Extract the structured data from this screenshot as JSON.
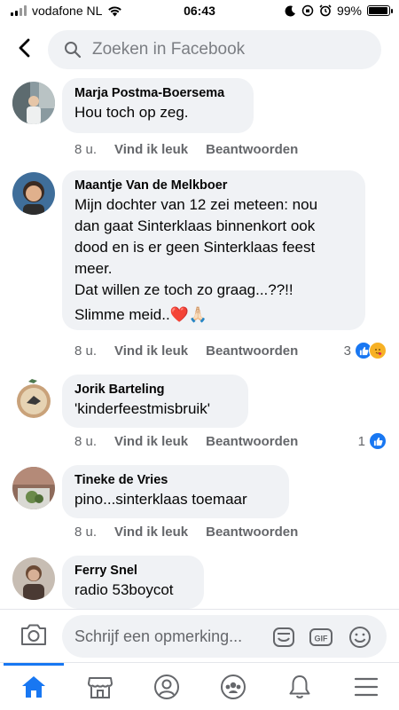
{
  "status": {
    "carrier": "vodafone NL",
    "time": "06:43",
    "battery": "99%"
  },
  "search": {
    "placeholder": "Zoeken in Facebook"
  },
  "actions_labels": {
    "like": "Vind ik leuk",
    "reply": "Beantwoorden"
  },
  "comments": [
    {
      "author": "Marja Postma-Boersema",
      "lines": [
        "Hou toch op zeg."
      ],
      "time": "8 u.",
      "reaction_count": ""
    },
    {
      "author": "Maantje Van de Melkboer",
      "lines": [
        "Mijn dochter van 12 zei meteen: nou",
        "dan gaat Sinterklaas binnenkort ook",
        "dood en is er geen Sinterklaas feest",
        "meer.",
        "Dat willen ze toch zo graag...??!!",
        "Slimme meid..❤️🙏🏻"
      ],
      "time": "8 u.",
      "reaction_count": "3"
    },
    {
      "author": "Jorik Barteling",
      "lines": [
        "'kinderfeestmisbruik'"
      ],
      "time": "8 u.",
      "reaction_count": "1"
    },
    {
      "author": "Tineke de Vries",
      "lines": [
        "pino...sinterklaas  toemaar"
      ],
      "time": "8 u.",
      "reaction_count": ""
    },
    {
      "author": "Ferry Snel",
      "lines": [
        "radio 53boycot"
      ],
      "time": "",
      "reaction_count": ""
    }
  ],
  "composer": {
    "placeholder": "Schrijf een opmerking..."
  },
  "tabs": [
    "home-icon",
    "marketplace-icon",
    "profile-icon",
    "groups-icon",
    "notifications-icon",
    "menu-icon"
  ],
  "colors": {
    "accent": "#1877f2",
    "bubble": "#f0f2f5",
    "secondary_text": "#65676b",
    "heart": "#e0245e",
    "care": "#f7b125"
  }
}
